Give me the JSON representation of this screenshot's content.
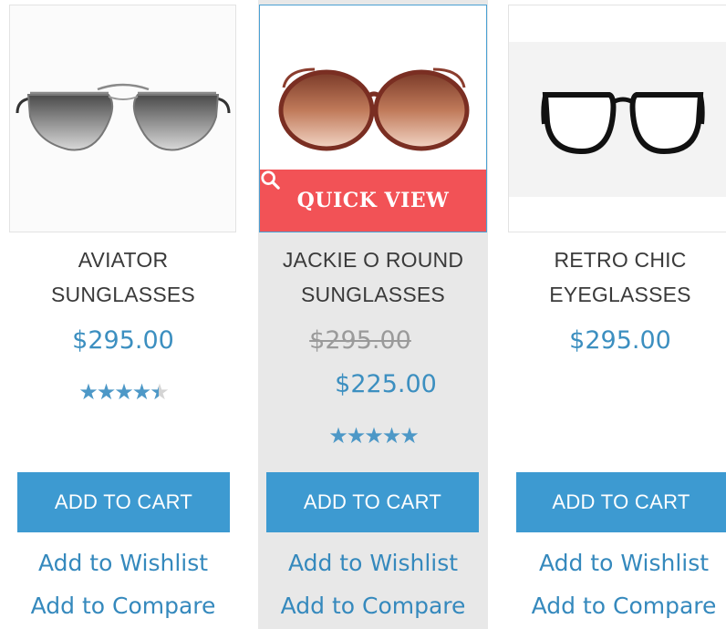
{
  "products": [
    {
      "name_line1": "AVIATOR",
      "name_line2": "SUNGLASSES",
      "price": "$295.00",
      "rating": 4.5,
      "add_to_cart": "ADD TO CART",
      "wishlist": "Add to Wishlist",
      "compare": "Add to Compare"
    },
    {
      "name_line1": "JACKIE O ROUND",
      "name_line2": "SUNGLASSES",
      "old_price": "$295.00",
      "special_price": "$225.00",
      "rating": 5,
      "quick_view": "QUICK VIEW",
      "add_to_cart": "ADD TO CART",
      "wishlist": "Add to Wishlist",
      "compare": "Add to Compare"
    },
    {
      "name_line1": "RETRO CHIC",
      "name_line2": "EYEGLASSES",
      "price": "$295.00",
      "add_to_cart": "ADD TO CART",
      "wishlist": "Add to Wishlist",
      "compare": "Add to Compare"
    }
  ],
  "colors": {
    "accent": "#3d9ad1",
    "price": "#3c8fc0",
    "quick_view_bg": "#f25256",
    "hover_bg": "#e8e8e8"
  },
  "icons": {
    "quick_view": "search-icon",
    "rating": "star-icon"
  }
}
